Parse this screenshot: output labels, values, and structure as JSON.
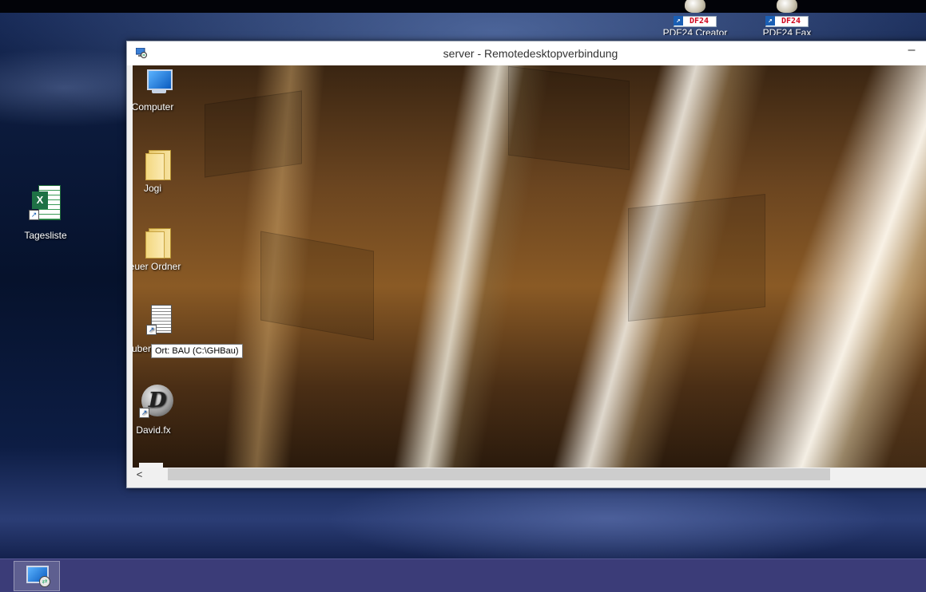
{
  "desktop": {
    "icons": [
      {
        "label": "PDF24 Creator",
        "badge": "DF24",
        "icon": "pdf24-creator-icon"
      },
      {
        "label": "PDF24 Fax",
        "badge": "DF24",
        "icon": "pdf24-fax-icon"
      },
      {
        "label": "Tagesliste",
        "icon": "excel-shortcut-icon",
        "badge": "X"
      }
    ]
  },
  "rdp_window": {
    "title": "server - Remotedesktopverbindung",
    "minimize_glyph": "–",
    "remote_desktop": {
      "icons": [
        {
          "label": "Computer",
          "icon": "computer-icon"
        },
        {
          "label": "Jogi",
          "icon": "folder-icon"
        },
        {
          "label": "euer Ordner",
          "icon": "folder-icon"
        },
        {
          "label": "uber",
          "icon": "document-shortcut-icon"
        },
        {
          "label": "David.fx",
          "icon": "david-fx-icon",
          "glyph": "D"
        }
      ],
      "tooltip": "Ort: BAU (C:\\GHBau)"
    },
    "scrollbar": {
      "left_arrow": "<"
    }
  },
  "taskbar": {
    "items": [
      {
        "name": "Remotedesktopverbindung",
        "icon": "remote-desktop-icon"
      }
    ],
    "color": "#3b3c78"
  },
  "colors": {
    "taskbar": "#3b3c78",
    "titlebar": "#ffffff",
    "tooltip_bg": "#ffffff"
  }
}
